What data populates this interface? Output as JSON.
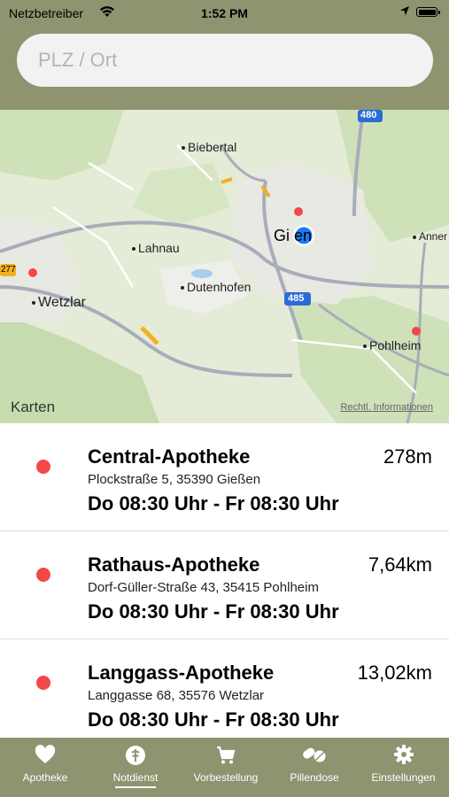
{
  "status": {
    "carrier": "Netzbetreiber",
    "time": "1:52 PM"
  },
  "search": {
    "placeholder": "PLZ / Ort",
    "value": ""
  },
  "map": {
    "labels": [
      "Biebertal",
      "Lahnau",
      "Gießen",
      "Dutenhofen",
      "Wetzlar",
      "Pohlheim",
      "Anner"
    ],
    "city_label": "Gi   en",
    "road_shields": [
      "480",
      "485",
      "277"
    ],
    "brand": "Karten",
    "legal": "Rechtl. Informationen"
  },
  "pharmacies": [
    {
      "name": "Central-Apotheke",
      "distance": "278m",
      "address": "Plockstraße 5, 35390 Gießen",
      "hours": "Do 08:30 Uhr - Fr 08:30 Uhr"
    },
    {
      "name": "Rathaus-Apotheke",
      "distance": "7,64km",
      "address": "Dorf-Güller-Straße 43, 35415 Pohlheim",
      "hours": "Do 08:30 Uhr - Fr 08:30 Uhr"
    },
    {
      "name": "Langgass-Apotheke",
      "distance": "13,02km",
      "address": "Langgasse 68, 35576 Wetzlar",
      "hours": "Do 08:30 Uhr - Fr 08:30 Uhr"
    }
  ],
  "tabs": [
    {
      "label": "Apotheke",
      "icon": "heart-icon"
    },
    {
      "label": "Notdienst",
      "icon": "emergency-icon",
      "active": true
    },
    {
      "label": "Vorbestellung",
      "icon": "cart-icon"
    },
    {
      "label": "Pillendose",
      "icon": "pills-icon"
    },
    {
      "label": "Einstellungen",
      "icon": "gear-icon"
    }
  ],
  "colors": {
    "accent": "#8f9370",
    "pin": "#f24848",
    "user_location": "#1a7cf5"
  }
}
